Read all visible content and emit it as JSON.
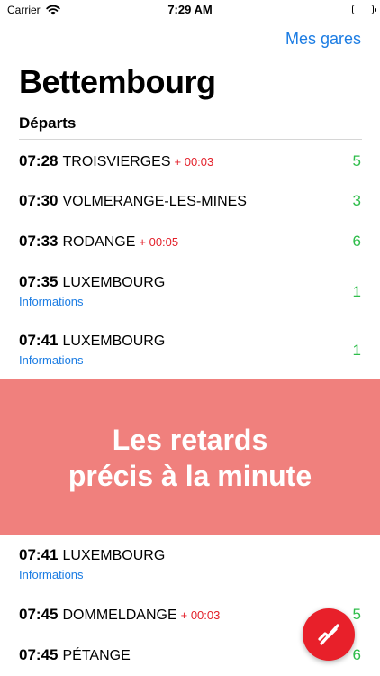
{
  "status_bar": {
    "carrier": "Carrier",
    "time": "7:29 AM"
  },
  "nav": {
    "link": "Mes gares"
  },
  "station": {
    "name": "Bettembourg"
  },
  "section": {
    "title": "Départs"
  },
  "departures": [
    {
      "time": "07:28",
      "destination": "TROISVIERGES",
      "delay": "+ 00:03",
      "info": "",
      "track": "5"
    },
    {
      "time": "07:30",
      "destination": "VOLMERANGE-LES-MINES",
      "delay": "",
      "info": "",
      "track": "3"
    },
    {
      "time": "07:33",
      "destination": "RODANGE",
      "delay": "+ 00:05",
      "info": "",
      "track": "6"
    },
    {
      "time": "07:35",
      "destination": "LUXEMBOURG",
      "delay": "",
      "info": "Informations",
      "track": "1"
    },
    {
      "time": "07:41",
      "destination": "LUXEMBOURG",
      "delay": "",
      "info": "Informations",
      "track": "1"
    },
    {
      "time": "07:41",
      "destination": "LUXEMBOURG",
      "delay": "",
      "info": "Informations",
      "track": ""
    },
    {
      "time": "07:45",
      "destination": "DOMMELDANGE",
      "delay": "+ 00:03",
      "info": "",
      "track": "5"
    },
    {
      "time": "07:45",
      "destination": "PÉTANGE",
      "delay": "",
      "info": "",
      "track": "6"
    }
  ],
  "promo": {
    "line1": "Les retards",
    "line2": "précis à la minute"
  },
  "colors": {
    "accent": "#1b7ce3",
    "delay": "#e3202a",
    "track": "#2ebd4a",
    "promo_bg": "#f0807d",
    "fab": "#e8202a"
  },
  "icons": {
    "fab": "no-delay-icon",
    "wifi": "wifi-icon",
    "battery": "battery-icon"
  }
}
